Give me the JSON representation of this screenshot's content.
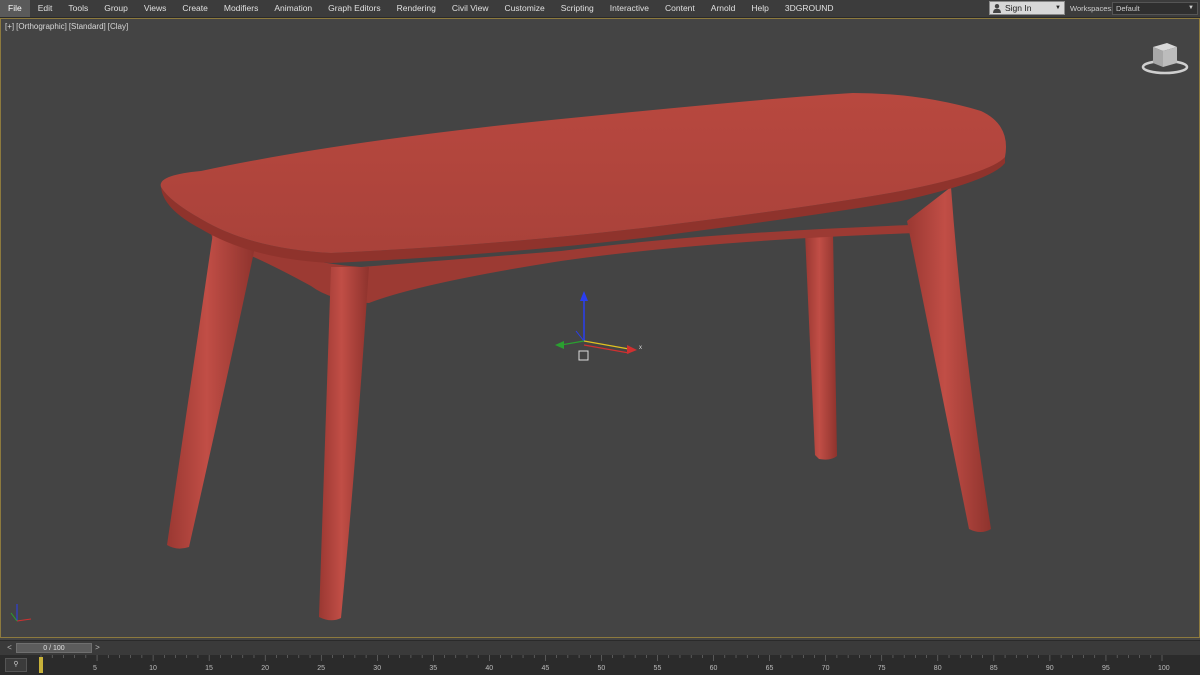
{
  "menu": {
    "items": [
      "File",
      "Edit",
      "Tools",
      "Group",
      "Views",
      "Create",
      "Modifiers",
      "Animation",
      "Graph Editors",
      "Rendering",
      "Civil View",
      "Customize",
      "Scripting",
      "Interactive",
      "Content",
      "Arnold",
      "Help",
      "3DGROUND"
    ],
    "active_index": 0
  },
  "signin": {
    "label": "Sign In"
  },
  "workspaces": {
    "label": "Workspaces:",
    "value": "Default"
  },
  "viewport": {
    "labels": [
      "[+]",
      "[Orthographic]",
      "[Standard]",
      "[Clay]"
    ],
    "model_color": "#b5463f",
    "gizmo_axes": {
      "x": "x",
      "y": "y",
      "z": "z"
    }
  },
  "timeslider": {
    "position": "0 / 100",
    "left_arrow": "<",
    "right_arrow": ">"
  },
  "trackbar": {
    "key_label": "⚲",
    "ticks": [
      5,
      10,
      15,
      20,
      25,
      30,
      35,
      40,
      45,
      50,
      55,
      60,
      65,
      70,
      75,
      80,
      85,
      90,
      95,
      100
    ],
    "current_frame": 0
  }
}
